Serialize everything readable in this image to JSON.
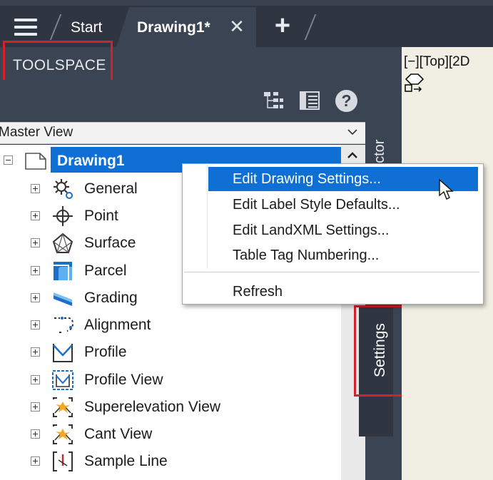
{
  "tabbar": {
    "start_label": "Start",
    "drawing_label": "Drawing1*",
    "close_glyph": "✕",
    "new_glyph": "+"
  },
  "toolspace": {
    "title": "TOOLSPACE",
    "help_glyph": "?",
    "view_select": "Master View",
    "vertical_tabs": {
      "prospector": "ector",
      "settings": "Settings"
    }
  },
  "tree": {
    "root": "Drawing1",
    "items": [
      {
        "label": "General",
        "icon": "gear-icon"
      },
      {
        "label": "Point",
        "icon": "point-icon"
      },
      {
        "label": "Surface",
        "icon": "surface-icon"
      },
      {
        "label": "Parcel",
        "icon": "parcel-icon"
      },
      {
        "label": "Grading",
        "icon": "grading-icon"
      },
      {
        "label": "Alignment",
        "icon": "alignment-icon"
      },
      {
        "label": "Profile",
        "icon": "profile-icon"
      },
      {
        "label": "Profile View",
        "icon": "profile-view-icon"
      },
      {
        "label": "Superelevation View",
        "icon": "superelevation-view-icon"
      },
      {
        "label": "Cant View",
        "icon": "cant-view-icon"
      },
      {
        "label": "Sample Line",
        "icon": "sample-line-icon"
      }
    ]
  },
  "context_menu": {
    "items": [
      "Edit Drawing Settings...",
      "Edit Label Style Defaults...",
      "Edit LandXML Settings...",
      "Table Tag Numbering..."
    ],
    "refresh": "Refresh"
  },
  "viewport": {
    "label": "[−][Top][2D"
  },
  "colors": {
    "accent": "#0f6fd4",
    "annotation_red": "#d4212a",
    "panel": "#3b4453",
    "tabbar": "#2f3642"
  }
}
